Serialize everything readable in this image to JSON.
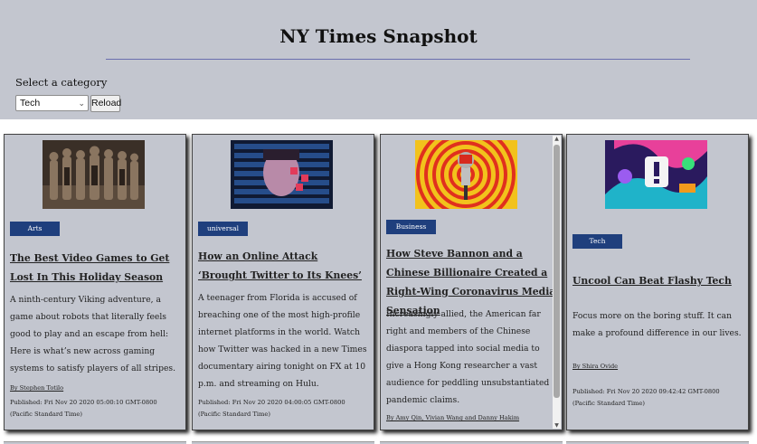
{
  "app": {
    "title": "NY Times Snapshot"
  },
  "category": {
    "label": "Select a category",
    "selected": "Tech",
    "reload_label": "Reload"
  },
  "articles": [
    {
      "section": "Arts",
      "headline": "The Best Video Games to Get Lost In This Holiday Season",
      "abstract": "A ninth-century Viking adventure, a game about robots that literally feels good to play and an escape from hell: Here is what’s new across gaming systems to satisfy players of all stripes.",
      "byline": "By Stephen Totilo",
      "published": "Published: Fri Nov 20 2020 05:00:10 GMT-0800 (Pacific Standard Time)"
    },
    {
      "section": "universal",
      "headline": "How an Online Attack ‘Brought Twitter to Its Knees’",
      "abstract": "A teenager from Florida is accused of breaching one of the most high-profile internet platforms in the world. Watch how Twitter was hacked in a new Times documentary airing tonight on FX at 10 p.m. and streaming on Hulu.",
      "byline": "",
      "published": "Published: Fri Nov 20 2020 04:00:05 GMT-0800 (Pacific Standard Time)"
    },
    {
      "section": "Business",
      "headline": "How Steve Bannon and a Chinese Billionaire Created a Right-Wing Coronavirus Media Sensation",
      "abstract": "Increasingly allied, the American far right and members of the Chinese diaspora tapped into social media to give a Hong Kong researcher a vast audience for peddling unsubstantiated pandemic claims.",
      "byline": "By Amy Qin, Vivian Wang and Danny Hakim",
      "published": ""
    },
    {
      "section": "Tech",
      "headline": "Uncool Can Beat Flashy Tech",
      "abstract": "Focus more on the boring stuff. It can make a profound difference in our lives.",
      "byline": "By Shira Ovide",
      "published": "Published: Fri Nov 20 2020 09:42:42 GMT-0800 (Pacific Standard Time)"
    }
  ],
  "icons": {
    "dropdown": "chevron-down-icon",
    "scroll_up": "arrow-up-icon",
    "scroll_down": "arrow-down-icon"
  },
  "colors": {
    "header_bg": "#c3c6cf",
    "badge_bg": "#1f3f7d",
    "title_rule": "#6a6fae"
  }
}
